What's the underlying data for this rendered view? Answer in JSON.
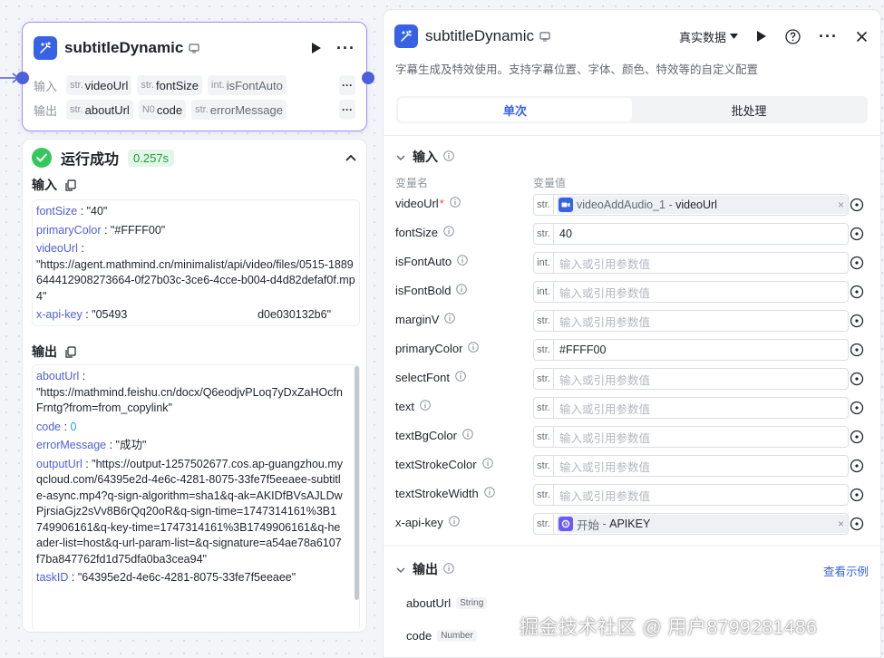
{
  "node": {
    "title": "subtitleDynamic",
    "inputs_label": "输入",
    "outputs_label": "输出",
    "inputs": [
      {
        "type": "str.",
        "name": "videoUrl"
      },
      {
        "type": "str.",
        "name": "fontSize"
      },
      {
        "type": "int.",
        "name": "isFontAuto"
      }
    ],
    "outputs": [
      {
        "type": "str.",
        "name": "aboutUrl"
      },
      {
        "type": "N0",
        "name": "code"
      },
      {
        "type": "str.",
        "name": "errorMessage"
      }
    ],
    "more_label": "···"
  },
  "run": {
    "status": "运行成功",
    "duration": "0.257s",
    "input_title": "输入",
    "output_title": "输出",
    "inputs": [
      {
        "key": "fontSize",
        "value": "\"40\""
      },
      {
        "key": "primaryColor",
        "value": "\"#FFFF00\""
      },
      {
        "key": "videoUrl",
        "value": "\"https://agent.mathmind.cn/minimalist/api/video/files/0515-1889644412908273664-0f27b03c-3ce6-4cce-b004-d4d82defaf0f.mp4\""
      },
      {
        "key": "x-api-key",
        "value_start": "\"05493",
        "value_end": "d0e030132b6\""
      }
    ],
    "outputs": [
      {
        "key": "aboutUrl",
        "value": "\"https://mathmind.feishu.cn/docx/Q6eodjvPLoq7yDxZaHOcfnFrntg?from=from_copylink\""
      },
      {
        "key": "code",
        "value": "0"
      },
      {
        "key": "errorMessage",
        "value": "\"成功\""
      },
      {
        "key": "outputUrl",
        "value": "\"https://output-1257502677.cos.ap-guangzhou.myqcloud.com/64395e2d-4e6c-4281-8075-33fe7f5eeaee-subtitle-async.mp4?q-sign-algorithm=sha1&q-ak=AKIDfBVsAJLDwPjrsiaGjz2sVv8B6rQq20oR&q-sign-time=1747314161%3B1749906161&q-key-time=1747314161%3B1749906161&q-header-list=host&q-url-param-list=&q-signature=a54ae78a6107f7ba847762fd1d75dfa0ba3cea94\""
      },
      {
        "key": "taskID",
        "value": "\"64395e2d-4e6c-4281-8075-33fe7f5eeaee\""
      }
    ]
  },
  "panel": {
    "title": "subtitleDynamic",
    "data_mode": "真实数据",
    "description": "字幕生成及特效使用。支持字幕位置、字体、颜色、特效等的自定义配置",
    "tabs": [
      "单次",
      "批处理"
    ],
    "input_section": "输入",
    "col_name": "变量名",
    "col_value": "变量值",
    "placeholder": "输入或引用参数值",
    "vars": [
      {
        "name": "videoUrl",
        "required": true,
        "type": "str.",
        "ref_source": "videoAddAudio_1",
        "ref_field": "videoUrl"
      },
      {
        "name": "fontSize",
        "type": "str.",
        "value": "40"
      },
      {
        "name": "isFontAuto",
        "type": "int.",
        "value": ""
      },
      {
        "name": "isFontBold",
        "type": "int.",
        "value": ""
      },
      {
        "name": "marginV",
        "type": "str.",
        "value": ""
      },
      {
        "name": "primaryColor",
        "type": "str.",
        "value": "#FFFF00"
      },
      {
        "name": "selectFont",
        "type": "str.",
        "value": ""
      },
      {
        "name": "text",
        "type": "str.",
        "value": ""
      },
      {
        "name": "textBgColor",
        "type": "str.",
        "value": ""
      },
      {
        "name": "textStrokeColor",
        "type": "str.",
        "value": ""
      },
      {
        "name": "textStrokeWidth",
        "type": "str.",
        "value": ""
      },
      {
        "name": "x-api-key",
        "type": "str.",
        "ref_source": "开始",
        "ref_field": "APIKEY"
      }
    ],
    "output_section": "输出",
    "demo_link": "查看示例",
    "outputs": [
      {
        "name": "aboutUrl",
        "type": "String"
      },
      {
        "name": "code",
        "type": "Number"
      }
    ]
  },
  "watermark": "掘金技术社区 @ 用户8799281486",
  "colors": {
    "accent": "#3662e3",
    "port": "#4e5fdc",
    "success": "#34c759",
    "node_border": "#9d8df7"
  }
}
